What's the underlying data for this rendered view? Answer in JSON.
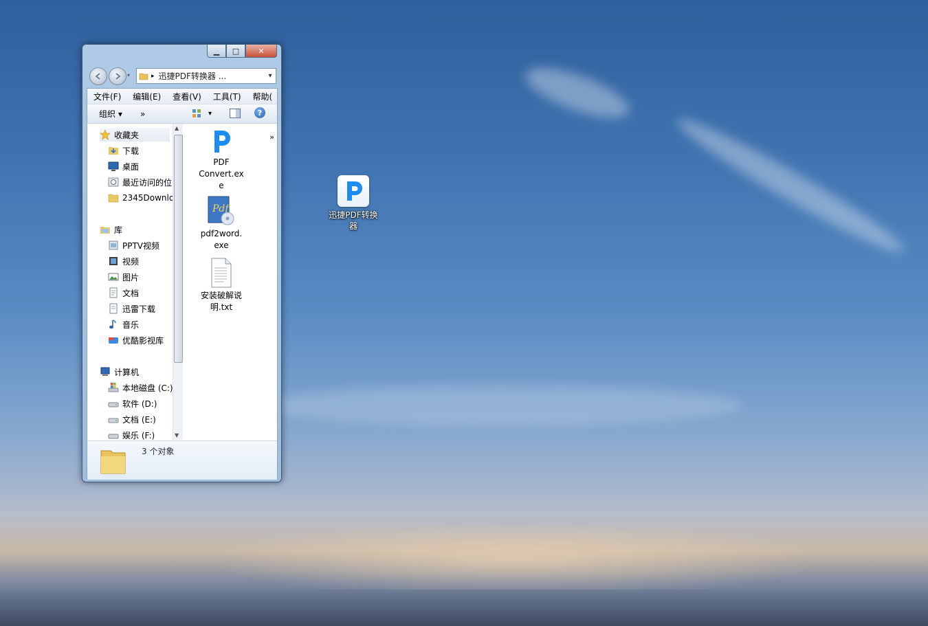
{
  "desktop": {
    "icon": {
      "label_line1": "迅捷PDF转换",
      "label_line2": "器",
      "icon": "pdf-converter-icon"
    }
  },
  "window": {
    "caption": {
      "minimize": "▁",
      "maximize": "□",
      "close": "✕"
    },
    "address": {
      "separator": "▸",
      "path": "迅捷PDF转换器 ...",
      "dropdown": "▾"
    },
    "menu": [
      "文件(F)",
      "编辑(E)",
      "查看(V)",
      "工具(T)",
      "帮助("
    ],
    "menu_more": "»",
    "toolbar": {
      "organize": "组织 ▾",
      "more": "»",
      "view_dropdown": "▾",
      "help": "?"
    },
    "nav": {
      "favorites": {
        "label": "收藏夹",
        "items": [
          "下载",
          "桌面",
          "最近访问的位",
          "2345Downlo"
        ]
      },
      "libraries": {
        "label": "库",
        "items": [
          "PPTV视频",
          "视频",
          "图片",
          "文档",
          "迅雷下载",
          "音乐",
          "优酷影视库"
        ]
      },
      "computer": {
        "label": "计算机",
        "items": [
          "本地磁盘 (C:)",
          "软件 (D:)",
          "文档 (E:)",
          "娱乐 (F:)"
        ]
      }
    },
    "files": [
      {
        "name_line1": "PDF",
        "name_line2": "Convert.ex",
        "name_line3": "e",
        "icon": "pdf-convert-exe-icon"
      },
      {
        "name_line1": "pdf2word.",
        "name_line2": "exe",
        "icon": "pdf2word-exe-icon"
      },
      {
        "name_line1": "安装破解说",
        "name_line2": "明.txt",
        "icon": "text-file-icon"
      }
    ],
    "status": {
      "count": "3 个对象"
    }
  }
}
